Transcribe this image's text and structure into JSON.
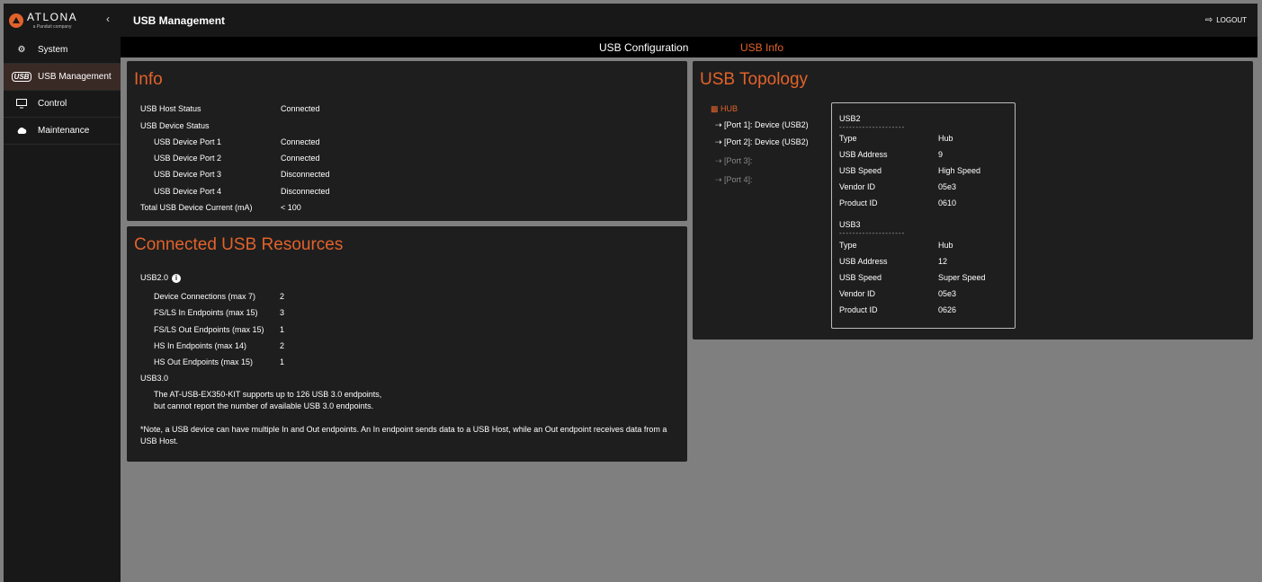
{
  "sidebar": {
    "logo_text": "ATLONA",
    "logo_sub": "a Panduit company",
    "collapse_icon": "chevron-left-icon",
    "items": [
      {
        "label": "System",
        "icon": "gear-icon"
      },
      {
        "label": "USB Management",
        "icon": "usb-icon",
        "badge": "USB"
      },
      {
        "label": "Control",
        "icon": "monitor-icon"
      },
      {
        "label": "Maintenance",
        "icon": "cloud-icon"
      }
    ]
  },
  "header": {
    "title": "USB Management",
    "logout_label": "LOGOUT"
  },
  "tabs": [
    {
      "label": "USB Configuration",
      "active": false
    },
    {
      "label": "USB Info",
      "active": true
    }
  ],
  "info": {
    "title": "Info",
    "rows": [
      {
        "label": "USB Host Status",
        "value": "Connected"
      },
      {
        "label": "USB Device Status",
        "value": ""
      },
      {
        "label": "USB Device Port 1",
        "value": "Connected"
      },
      {
        "label": "USB Device Port 2",
        "value": "Connected"
      },
      {
        "label": "USB Device Port 3",
        "value": "Disconnected"
      },
      {
        "label": "USB Device Port 4",
        "value": "Disconnected"
      },
      {
        "label": "Total USB Device Current (mA)",
        "value": "< 100"
      }
    ]
  },
  "resources": {
    "title": "Connected USB Resources",
    "usb2_label": "USB2.0",
    "usb2_rows": [
      {
        "label": "Device Connections (max 7)",
        "value": "2"
      },
      {
        "label": "FS/LS In Endpoints (max 15)",
        "value": "3"
      },
      {
        "label": "FS/LS Out Endpoints (max 15)",
        "value": "1"
      },
      {
        "label": "HS In Endpoints (max 14)",
        "value": "2"
      },
      {
        "label": "HS Out Endpoints (max 15)",
        "value": "1"
      }
    ],
    "usb3_label": "USB3.0",
    "usb3_line1": "The AT-USB-EX350-KIT supports up to 126 USB 3.0 endpoints,",
    "usb3_line2": "but cannot report the number of available USB 3.0 endpoints.",
    "note_line1": "*Note, a USB device can have multiple In and Out endpoints. An In endpoint sends data to a USB Host, while an Out endpoint receives data from a",
    "note_line2": "USB Host."
  },
  "topology": {
    "title": "USB Topology",
    "hub_label": "HUB",
    "ports": [
      {
        "label": "[Port 1]: Device (USB2)",
        "enabled": true
      },
      {
        "label": "[Port 2]: Device (USB2)",
        "enabled": true
      },
      {
        "label": "[Port 3]:",
        "enabled": false
      },
      {
        "label": "[Port 4]:",
        "enabled": false
      }
    ],
    "details": {
      "usb2_header": "USB2",
      "usb2_rows": [
        {
          "label": "Type",
          "value": "Hub"
        },
        {
          "label": "USB Address",
          "value": "9"
        },
        {
          "label": "USB Speed",
          "value": "High Speed"
        },
        {
          "label": "Vendor ID",
          "value": "05e3"
        },
        {
          "label": "Product ID",
          "value": "0610"
        }
      ],
      "usb3_header": "USB3",
      "usb3_rows": [
        {
          "label": "Type",
          "value": "Hub"
        },
        {
          "label": "USB Address",
          "value": "12"
        },
        {
          "label": "USB Speed",
          "value": "Super Speed"
        },
        {
          "label": "Vendor ID",
          "value": "05e3"
        },
        {
          "label": "Product ID",
          "value": "0626"
        }
      ],
      "divider": "--------------------"
    }
  },
  "colors": {
    "accent": "#e2622b",
    "panel": "#1e1e1e",
    "background": "#7f7f7f",
    "sidebar": "#181818"
  }
}
